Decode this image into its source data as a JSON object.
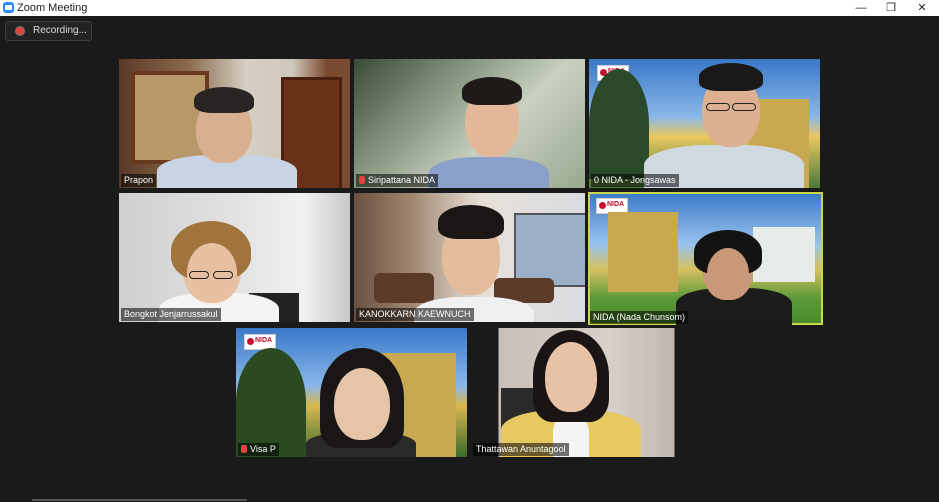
{
  "window": {
    "title": "Zoom Meeting",
    "minimize_glyph": "—",
    "restore_glyph": "❐",
    "close_glyph": "✕"
  },
  "recording": {
    "label": "Recording..."
  },
  "participants": [
    {
      "name": "Prapon",
      "muted": false
    },
    {
      "name": "Siripattana NIDA",
      "muted": true
    },
    {
      "name": "0 NIDA - Jongsawas",
      "muted": false
    },
    {
      "name": "Bongkot Jenjarrussakul",
      "muted": false
    },
    {
      "name": "KANOKKARN KAEWNUCH",
      "muted": false
    },
    {
      "name": "NIDA (Nada Chunsom)",
      "muted": false,
      "active_speaker": true
    },
    {
      "name": "Visa P",
      "muted": true
    },
    {
      "name": "Thattawan Anuntagool",
      "muted": false
    }
  ],
  "colors": {
    "active_border": "#c9d84a",
    "recording_dot": "#e0433c",
    "background": "#1a1a1a"
  }
}
